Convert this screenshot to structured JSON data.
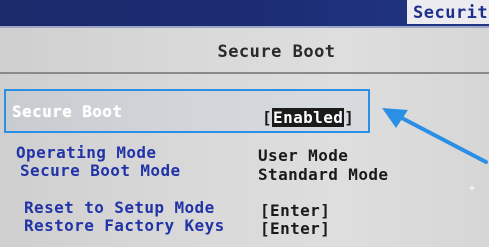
{
  "top_tab": {
    "label": "Securit"
  },
  "page": {
    "title": "Secure Boot"
  },
  "selected_setting": {
    "label": "Secure Boot",
    "value": "Enabled",
    "open_bracket": "[",
    "close_bracket": "]"
  },
  "settings": [
    {
      "label": "Operating Mode",
      "value": "User Mode"
    },
    {
      "label": "Secure Boot Mode",
      "value": "Standard Mode"
    }
  ],
  "actions": [
    {
      "label": "Reset to Setup Mode",
      "value": "[Enter]"
    },
    {
      "label": "Restore Factory Keys",
      "value": "[Enter]"
    }
  ],
  "colors": {
    "top_band": "#1b2c73",
    "option_label": "#2233a8",
    "highlight_border": "#2c8fe6",
    "arrow": "#2c8fe6",
    "background": "#d9d9d9"
  }
}
